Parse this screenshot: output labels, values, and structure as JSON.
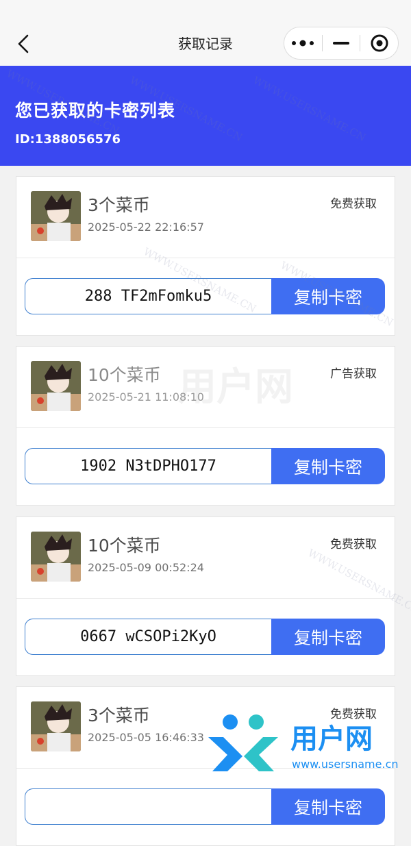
{
  "nav": {
    "title": "获取记录"
  },
  "header": {
    "heading": "您已获取的卡密列表",
    "id_text": "ID:1388056576"
  },
  "records": [
    {
      "amount": "3个菜币",
      "time": "2025-05-22 22:16:57",
      "method": "免费获取",
      "code": "288 TF2mFomku5",
      "copy_label": "复制卡密"
    },
    {
      "amount": "10个菜币",
      "time": "2025-05-21 11:08:10",
      "method": "广告获取",
      "code": "1902 N3tDPHO177",
      "copy_label": "复制卡密"
    },
    {
      "amount": "10个菜币",
      "time": "2025-05-09 00:52:24",
      "method": "免费获取",
      "code": "0667 wCSOPi2KyO",
      "copy_label": "复制卡密"
    },
    {
      "amount": "3个菜币",
      "time": "2025-05-05 16:46:33",
      "method": "免费获取",
      "code": "",
      "copy_label": "复制卡密"
    }
  ],
  "watermark": {
    "text": "WWW.USERSNAME.CN",
    "center_text": "用户网"
  },
  "logo": {
    "name": "用户网",
    "url": "www.usersname.cn"
  },
  "colors": {
    "banner": "#3a48f1",
    "copy_button": "#3f6ef2",
    "code_border": "#3e7fcf",
    "logo_blue": "#1c8ff2",
    "logo_teal": "#2ec3c8"
  },
  "icons": {
    "back": "chevron-left-icon",
    "more": "more-dots-icon",
    "minimize": "minus-icon",
    "close": "target-circle-icon"
  }
}
